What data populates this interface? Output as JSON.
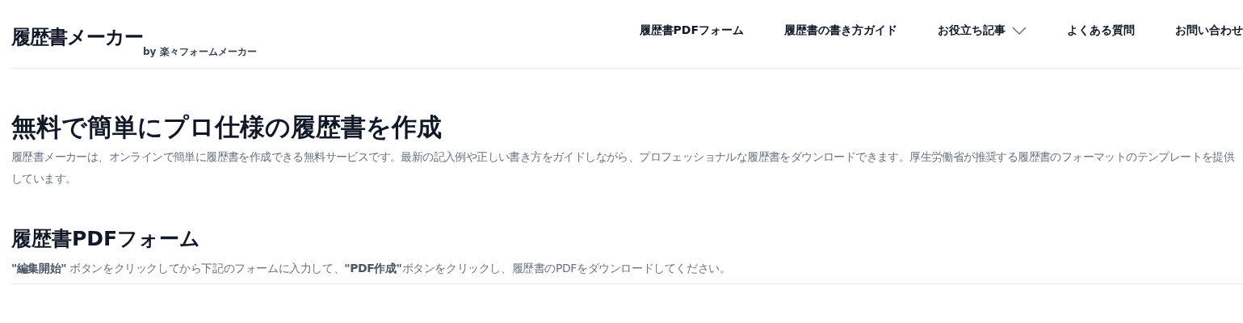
{
  "header": {
    "logo": "履歴書メーカー",
    "logo_sub": "by 楽々フォームメーカー",
    "nav": [
      {
        "label": "履歴書PDFフォーム",
        "kind": "link"
      },
      {
        "label": "履歴書の書き方ガイド",
        "kind": "link"
      },
      {
        "label": "お役立ち記事",
        "kind": "dropdown"
      },
      {
        "label": "よくある質問",
        "kind": "link"
      },
      {
        "label": "お問い合わせ",
        "kind": "link"
      }
    ]
  },
  "hero": {
    "title": "無料で簡単にプロ仕様の履歴書を作成",
    "description": "履歴書メーカーは、オンラインで簡単に履歴書を作成できる無料サービスです。最新の記入例や正しい書き方をガイドしながら、プロフェッショナルな履歴書をダウンロードできます。厚生労働省が推奨する履歴書のフォーマットのテンプレートを提供しています。"
  },
  "form_section": {
    "title": "履歴書PDFフォーム",
    "instructions": "**\"編集開始\"** ボタンをクリックしてから下記のフォームに入力して、**\"PDF作成\"**ボタンをクリックし、履歴書のPDFをダウンロードしてください。"
  }
}
